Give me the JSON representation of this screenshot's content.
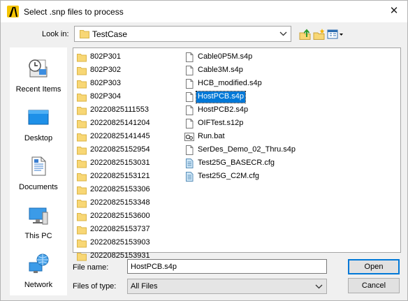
{
  "window": {
    "title": "Select .snp files to process",
    "close_glyph": "✕"
  },
  "toolbar": {
    "look_in_label": "Look in:",
    "look_in_value": "TestCase",
    "buttons": [
      "up-folder-icon",
      "new-folder-icon",
      "view-menu-icon"
    ]
  },
  "places": [
    {
      "label": "Recent Items",
      "icon": "recent-items-icon"
    },
    {
      "label": "Desktop",
      "icon": "desktop-icon"
    },
    {
      "label": "Documents",
      "icon": "documents-icon"
    },
    {
      "label": "This PC",
      "icon": "this-pc-icon"
    },
    {
      "label": "Network",
      "icon": "network-icon"
    }
  ],
  "files": {
    "folders": [
      "802P301",
      "802P302",
      "802P303",
      "802P304",
      "20220825111553",
      "20220825141204",
      "20220825141445",
      "20220825152954",
      "20220825153031",
      "20220825153121",
      "20220825153306",
      "20220825153348",
      "20220825153600",
      "20220825153737",
      "20220825153903",
      "20220825153931"
    ],
    "items": [
      {
        "name": "Cable0P5M.s4p",
        "type": "doc"
      },
      {
        "name": "Cable3M.s4p",
        "type": "doc"
      },
      {
        "name": "HCB_modified.s4p",
        "type": "doc"
      },
      {
        "name": "HostPCB.s4p",
        "type": "doc",
        "selected": true
      },
      {
        "name": "HostPCB2.s4p",
        "type": "doc"
      },
      {
        "name": "OIFTest.s12p",
        "type": "doc"
      },
      {
        "name": "Run.bat",
        "type": "bat"
      },
      {
        "name": "SerDes_Demo_02_Thru.s4p",
        "type": "doc"
      },
      {
        "name": "Test25G_BASECR.cfg",
        "type": "cfg"
      },
      {
        "name": "Test25G_C2M.cfg",
        "type": "cfg"
      }
    ]
  },
  "footer": {
    "file_name_label": "File name:",
    "file_name_value": "HostPCB.s4p",
    "files_of_type_label": "Files of type:",
    "files_of_type_value": "All Files",
    "open_label": "Open",
    "cancel_label": "Cancel"
  },
  "colors": {
    "selection": "#0078d7",
    "folder": "#f8d775",
    "window_bg": "#f0f0f0"
  }
}
